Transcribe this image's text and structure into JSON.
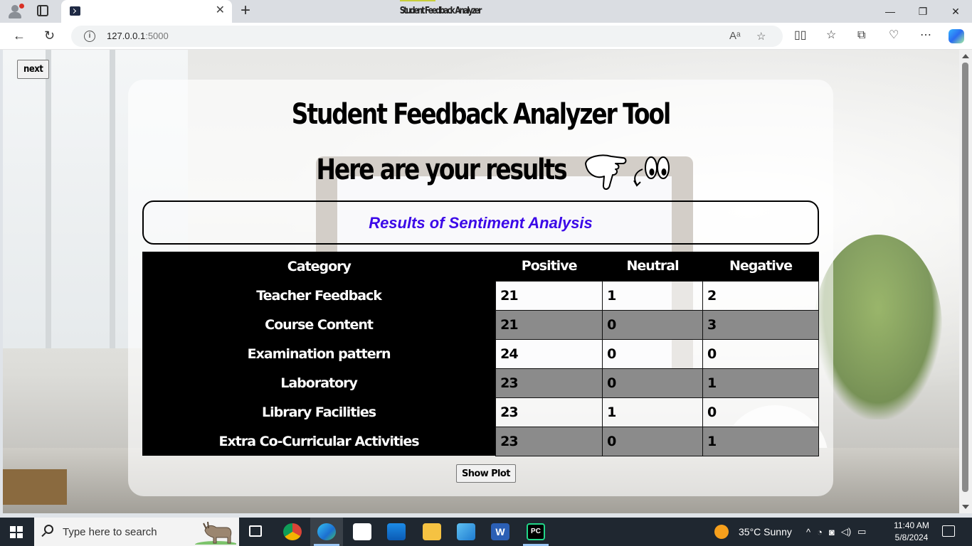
{
  "browser": {
    "tab_title": "Student Feedback Analyzer",
    "url_host": "127.0.0.1",
    "url_port": ":5000"
  },
  "page": {
    "next_label": "next",
    "title": "Student Feedback Analyzer Tool",
    "subtitle": "Here are your results",
    "results_heading": "Results of Sentiment Analysis",
    "show_plot_label": "Show Plot",
    "accent_color": "#3b08e8"
  },
  "table": {
    "headers": [
      "Category",
      "Positive",
      "Neutral",
      "Negative"
    ],
    "rows": [
      {
        "category": "Teacher Feedback",
        "positive": "21",
        "neutral": "1",
        "negative": "2"
      },
      {
        "category": "Course Content",
        "positive": "21",
        "neutral": "0",
        "negative": "3"
      },
      {
        "category": "Examination pattern",
        "positive": "24",
        "neutral": "0",
        "negative": "0"
      },
      {
        "category": "Laboratory",
        "positive": "23",
        "neutral": "0",
        "negative": "1"
      },
      {
        "category": "Library Facilities",
        "positive": "23",
        "neutral": "1",
        "negative": "0"
      },
      {
        "category": "Extra Co-Curricular Activities",
        "positive": "23",
        "neutral": "0",
        "negative": "1"
      }
    ]
  },
  "taskbar": {
    "search_placeholder": "Type here to search",
    "weather": "35°C  Sunny",
    "time": "11:40 AM",
    "date": "5/8/2024"
  }
}
